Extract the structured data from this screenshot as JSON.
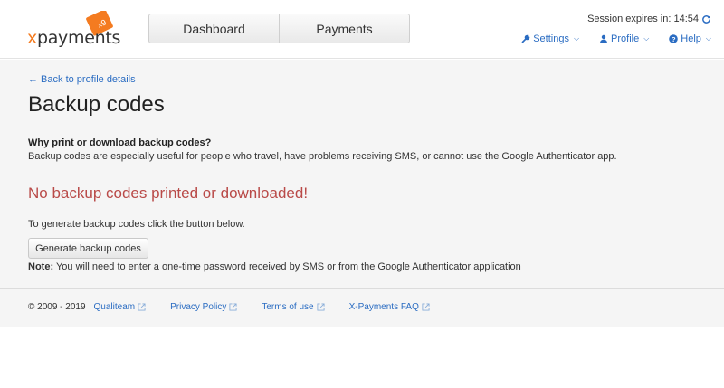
{
  "header": {
    "logo_text": "xpayments",
    "logo_badge": "x9",
    "nav_tabs": [
      "Dashboard",
      "Payments"
    ],
    "session_label": "Session expires in: 14:54",
    "menus": [
      {
        "label": "Settings",
        "icon": "wrench-icon"
      },
      {
        "label": "Profile",
        "icon": "user-icon"
      },
      {
        "label": "Help",
        "icon": "question-circle-icon"
      }
    ]
  },
  "main": {
    "back_link": "← Back to profile details",
    "title": "Backup codes",
    "why_heading": "Why print or download backup codes?",
    "why_text": "Backup codes are especially useful for people who travel, have problems receiving SMS, or cannot use the Google Authenticator app.",
    "warning": "No backup codes printed or downloaded!",
    "generate_hint": "To generate backup codes click the button below.",
    "generate_button": "Generate backup codes",
    "note_label": "Note:",
    "note_text": " You will need to enter a one-time password received by SMS or from the Google Authenticator application"
  },
  "footer": {
    "copyright": "© 2009 - 2019",
    "links": [
      "Qualiteam",
      "Privacy Policy",
      "Terms of use",
      "X-Payments FAQ"
    ]
  },
  "colors": {
    "brand_orange": "#f47b20",
    "link_blue": "#2a6cc2",
    "warning_red": "#b94a48"
  }
}
